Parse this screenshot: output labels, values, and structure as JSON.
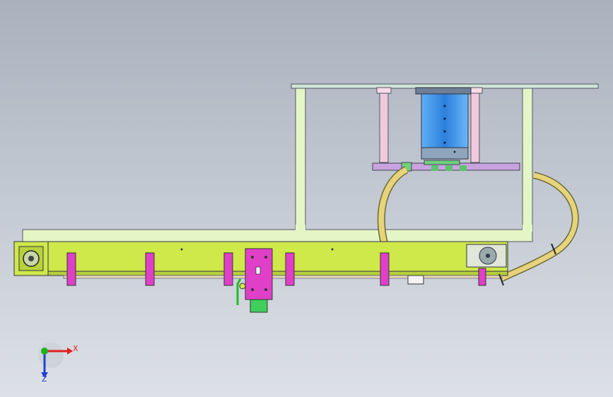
{
  "viewport": {
    "background_top": "#a9b1bd",
    "background_bottom": "#dde1e6"
  },
  "colors": {
    "frame": "#e4f5c6",
    "rail": "#cfe84a",
    "bracket": "#e040c8",
    "cylinder": "#3b8ee6",
    "cable": "#e7d37a",
    "plate": "#b8dfc8",
    "carriage": "#3fcf5a"
  },
  "axis_triad": {
    "x_label": "X",
    "z_label": "Z",
    "x_color": "#e02020",
    "y_color": "#20b020",
    "z_color": "#2040d0"
  }
}
